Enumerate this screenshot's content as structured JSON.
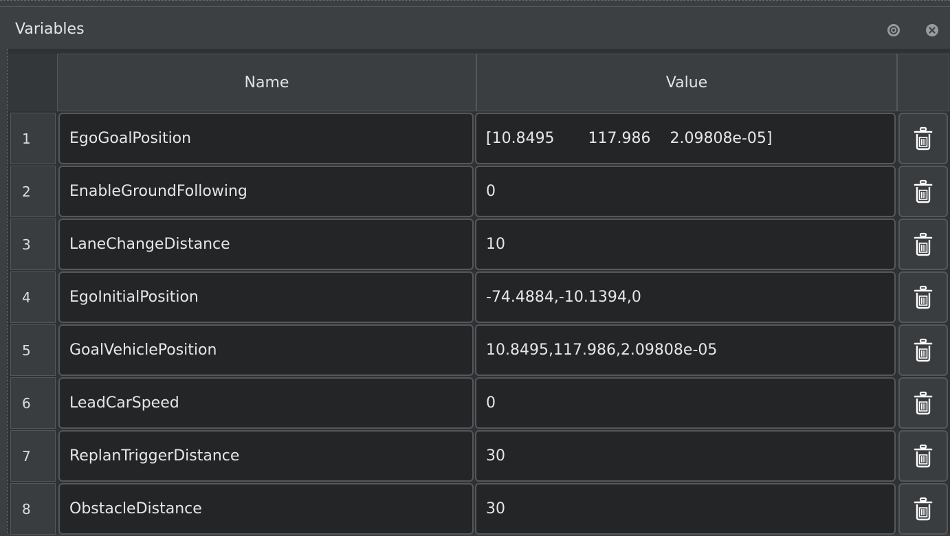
{
  "window": {
    "title": "Variables",
    "icons": [
      "settings-circle-icon",
      "close-circle-icon"
    ]
  },
  "table": {
    "columns": [
      "Name",
      "Value"
    ],
    "rows": [
      {
        "index": "1",
        "name": "EgoGoalPosition",
        "value": "[10.8495       117.986    2.09808e-05]"
      },
      {
        "index": "2",
        "name": "EnableGroundFollowing",
        "value": "0"
      },
      {
        "index": "3",
        "name": "LaneChangeDistance",
        "value": "10"
      },
      {
        "index": "4",
        "name": "EgoInitialPosition",
        "value": "-74.4884,-10.1394,0"
      },
      {
        "index": "5",
        "name": "GoalVehiclePosition",
        "value": "10.8495,117.986,2.09808e-05"
      },
      {
        "index": "6",
        "name": "LeadCarSpeed",
        "value": "0"
      },
      {
        "index": "7",
        "name": "ReplanTriggerDistance",
        "value": "30"
      },
      {
        "index": "8",
        "name": "ObstacleDistance",
        "value": "30"
      }
    ],
    "row_action_icon": "trash-icon"
  }
}
